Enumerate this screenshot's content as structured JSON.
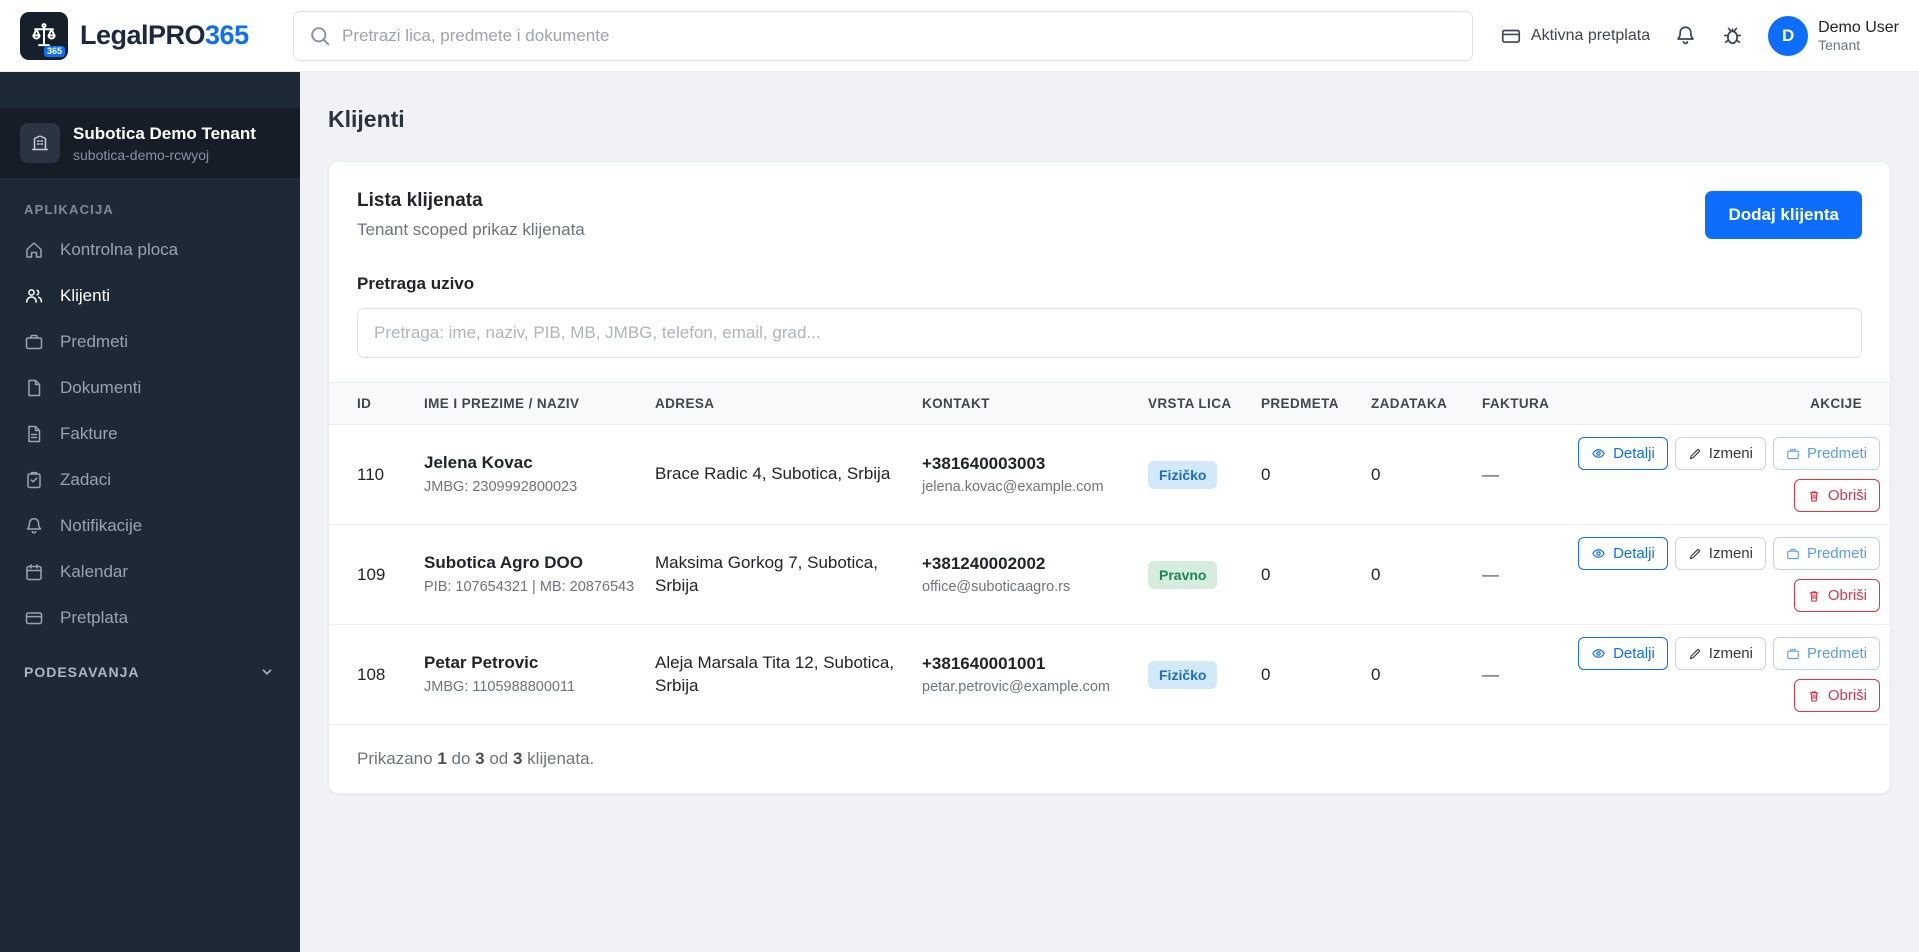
{
  "colors": {
    "accent": "#0d6efd",
    "sidebar_bg": "#1e2936",
    "danger": "#dc3545",
    "success": "#198754",
    "badge_fizicko_bg": "#d3e8f8",
    "badge_fizicko_text": "#1a6fc4",
    "badge_pravno_bg": "#d6ecdd",
    "badge_pravno_text": "#198754"
  },
  "header": {
    "brand_primary": "LegalPRO",
    "brand_accent": "365",
    "logo_badge": "365",
    "search_placeholder": "Pretrazi lica, predmete i dokumente",
    "subscription_label": "Aktivna pretplata",
    "user_initial": "D",
    "user_name": "Demo User",
    "user_role": "Tenant"
  },
  "sidebar": {
    "tenant_name": "Subotica Demo Tenant",
    "tenant_slug": "subotica-demo-rcwyoj",
    "section_app": "APLIKACIJA",
    "items": [
      {
        "label": "Kontrolna ploca"
      },
      {
        "label": "Klijenti"
      },
      {
        "label": "Predmeti"
      },
      {
        "label": "Dokumenti"
      },
      {
        "label": "Fakture"
      },
      {
        "label": "Zadaci"
      },
      {
        "label": "Notifikacije"
      },
      {
        "label": "Kalendar"
      },
      {
        "label": "Pretplata"
      }
    ],
    "section_settings": "PODESAVANJA"
  },
  "main": {
    "page_title": "Klijenti",
    "list": {
      "title": "Lista klijenata",
      "subtitle": "Tenant scoped prikaz klijenata",
      "add_button": "Dodaj klijenta",
      "search_label": "Pretraga uzivo",
      "search_placeholder": "Pretraga: ime, naziv, PIB, MB, JMBG, telefon, email, grad..."
    },
    "table": {
      "headers": [
        "ID",
        "IME I PREZIME / NAZIV",
        "ADRESA",
        "KONTAKT",
        "VRSTA LICA",
        "PREDMETA",
        "ZADATAKA",
        "FAKTURA",
        "AKCIJE"
      ],
      "actions": {
        "details": "Detalji",
        "edit": "Izmeni",
        "cases": "Predmeti",
        "delete": "Obriši"
      },
      "rows": [
        {
          "id": "110",
          "name": "Jelena Kovac",
          "meta": "JMBG: 2309992800023",
          "address": "Brace Radic 4, Subotica, Srbija",
          "phone": "+381640003003",
          "email": "jelena.kovac@example.com",
          "type": "Fizičko",
          "predmeta": "0",
          "zadataka": "0",
          "faktura": "—"
        },
        {
          "id": "109",
          "name": "Subotica Agro DOO",
          "meta": "PIB: 107654321 | MB: 20876543",
          "address": "Maksima Gorkog 7, Subotica, Srbija",
          "phone": "+381240002002",
          "email": "office@suboticaagro.rs",
          "type": "Pravno",
          "predmeta": "0",
          "zadataka": "0",
          "faktura": "—"
        },
        {
          "id": "108",
          "name": "Petar Petrovic",
          "meta": "JMBG: 1105988800011",
          "address": "Aleja Marsala Tita 12, Subotica, Srbija",
          "phone": "+381640001001",
          "email": "petar.petrovic@example.com",
          "type": "Fizičko",
          "predmeta": "0",
          "zadataka": "0",
          "faktura": "—"
        }
      ],
      "footer": {
        "p1": "Prikazano ",
        "b1": "1",
        "p2": " do ",
        "b2": "3",
        "p3": " od ",
        "b3": "3",
        "p4": " klijenata."
      }
    }
  }
}
